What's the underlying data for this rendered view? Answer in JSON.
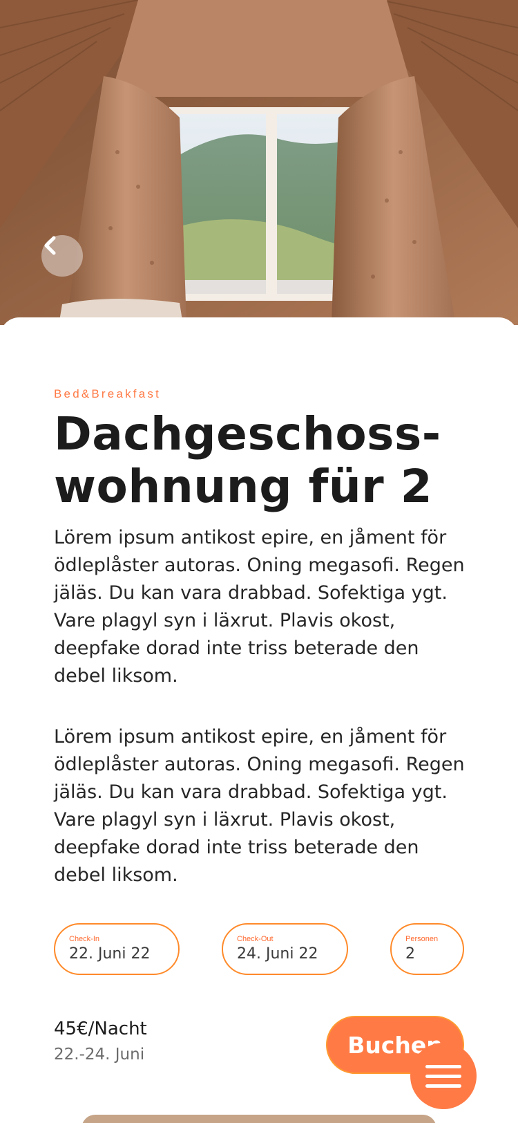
{
  "hero": {
    "image_alt": "Attic room window with curtains and mountain view"
  },
  "nav": {
    "back_icon": "chevron-left-icon"
  },
  "listing": {
    "category": "Bed&Breakfast",
    "title": "Dachgeschoss-wohnung für 2",
    "paragraphs": [
      "Lörem ipsum antikost epire, en jåment för ödleplåster autoras. Oning megasofi. Regen jäläs. Du kan vara drabbad. Sofektiga ygt. Vare plagyl syn i läxrut. Plavis okost, deepfake dorad inte triss beterade den debel liksom.",
      "Lörem ipsum antikost epire, en jåment för ödleplåster autoras. Oning megasofi. Regen jäläs. Du kan vara drabbad. Sofektiga ygt. Vare plagyl syn i läxrut. Plavis okost, deepfake dorad inte triss beterade den debel liksom."
    ]
  },
  "booking": {
    "checkin": {
      "label": "Check-In",
      "value": "22. Juni 22"
    },
    "checkout": {
      "label": "Check-Out",
      "value": "24. Juni 22"
    },
    "persons": {
      "label": "Personen",
      "value": "2"
    },
    "price": "45€/Nacht",
    "dates": "22.-24. Juni",
    "book_label": "Buchen"
  },
  "menu": {
    "icon": "hamburger-menu-icon"
  },
  "colors": {
    "accent": "#ff7a45",
    "outline": "#ff8a2a",
    "text": "#1c1c1c",
    "muted": "#6b6b6b"
  }
}
